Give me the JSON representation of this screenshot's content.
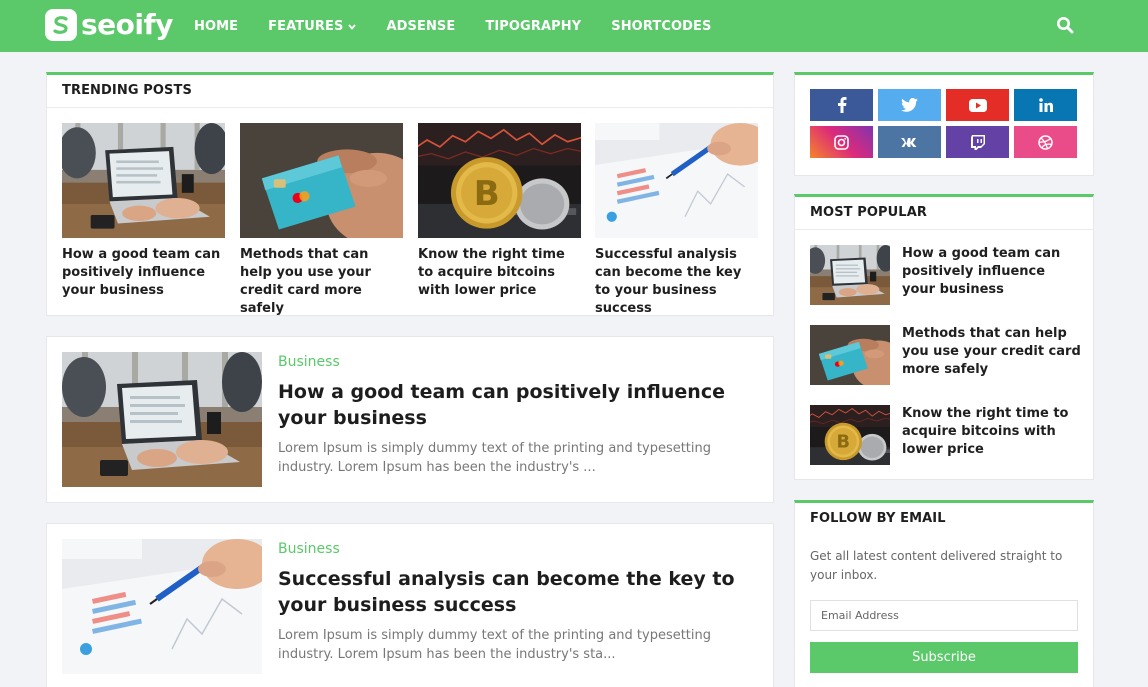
{
  "brand": {
    "name": "seoify",
    "accent": "#5bc86a"
  },
  "nav": {
    "items": [
      {
        "label": "HOME",
        "has_dropdown": false
      },
      {
        "label": "FEATURES",
        "has_dropdown": true
      },
      {
        "label": "ADSENSE",
        "has_dropdown": false
      },
      {
        "label": "TIPOGRAPHY",
        "has_dropdown": false
      },
      {
        "label": "SHORTCODES",
        "has_dropdown": false
      }
    ],
    "search_icon": "search-icon"
  },
  "trending": {
    "heading": "TRENDING POSTS",
    "items": [
      {
        "title": "How a good team can positively influence your business",
        "image": "laptop-team-photo"
      },
      {
        "title": "Methods that can help you use your credit card more safely",
        "image": "credit-card-photo"
      },
      {
        "title": "Know the right time to acquire bitcoins with lower price",
        "image": "bitcoin-photo"
      },
      {
        "title": "Successful analysis can become the key to your business success",
        "image": "chart-analysis-photo"
      }
    ]
  },
  "posts": [
    {
      "category": "Business",
      "title": "How a good team can positively influence your business",
      "excerpt": "Lorem Ipsum is simply dummy text of the printing and typesetting industry. Lorem Ipsum has been the industry's ...",
      "image": "laptop-team-photo"
    },
    {
      "category": "Business",
      "title": "Successful analysis can become the key to your business success",
      "excerpt": "Lorem Ipsum is simply dummy text of the printing and typesetting industry. Lorem Ipsum has been the industry's sta...",
      "image": "chart-analysis-photo"
    }
  ],
  "social": {
    "buttons": [
      {
        "icon": "facebook-icon",
        "color": "#3b5998"
      },
      {
        "icon": "twitter-icon",
        "color": "#55acee"
      },
      {
        "icon": "youtube-icon",
        "color": "#e52d27"
      },
      {
        "icon": "linkedin-icon",
        "color": "#0976b4"
      },
      {
        "icon": "instagram-icon",
        "color": "#c13584"
      },
      {
        "icon": "vk-icon",
        "color": "#4c75a3"
      },
      {
        "icon": "twitch-icon",
        "color": "#6441a5"
      },
      {
        "icon": "dribbble-icon",
        "color": "#ea4c89"
      }
    ]
  },
  "popular": {
    "heading": "MOST POPULAR",
    "items": [
      {
        "title": "How a good team can positively influence your business",
        "image": "laptop-team-photo"
      },
      {
        "title": "Methods that can help you use your credit card more safely",
        "image": "credit-card-photo"
      },
      {
        "title": "Know the right time to acquire bitcoins with lower price",
        "image": "bitcoin-photo"
      }
    ]
  },
  "follow": {
    "heading": "FOLLOW BY EMAIL",
    "description": "Get all latest content delivered straight to your inbox.",
    "email_placeholder": "Email Address",
    "button_label": "Subscribe"
  }
}
